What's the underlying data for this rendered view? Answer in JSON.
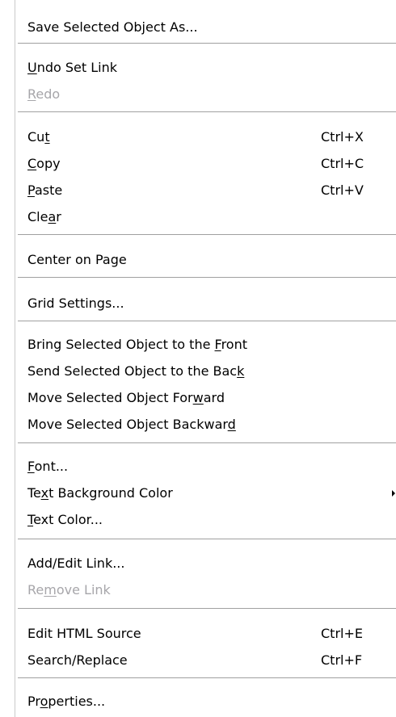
{
  "menu": {
    "save_selected": {
      "pre": "Save Selected Object As...",
      "u": "",
      "post": ""
    },
    "undo": {
      "pre": "",
      "u": "U",
      "post": "ndo Set Link"
    },
    "redo": {
      "pre": "",
      "u": "R",
      "post": "edo"
    },
    "cut": {
      "pre": "Cu",
      "u": "t",
      "post": "",
      "shortcut": "Ctrl+X"
    },
    "copy": {
      "pre": "",
      "u": "C",
      "post": "opy",
      "shortcut": "Ctrl+C"
    },
    "paste": {
      "pre": "",
      "u": "P",
      "post": "aste",
      "shortcut": "Ctrl+V"
    },
    "clear": {
      "pre": "Cle",
      "u": "a",
      "post": "r"
    },
    "center": {
      "pre": "Center on Page",
      "u": "",
      "post": ""
    },
    "grid": {
      "pre": "Grid Settings...",
      "u": "",
      "post": ""
    },
    "bring_front": {
      "pre": "Bring Selected Object to the ",
      "u": "F",
      "post": "ront"
    },
    "send_back": {
      "pre": "Send Selected Object to the Bac",
      "u": "k",
      "post": ""
    },
    "move_fwd": {
      "pre": "Move Selected Object For",
      "u": "w",
      "post": "ard"
    },
    "move_bwd": {
      "pre": "Move Selected Object Backwar",
      "u": "d",
      "post": ""
    },
    "font": {
      "pre": "",
      "u": "F",
      "post": "ont..."
    },
    "text_bg": {
      "pre": "Te",
      "u": "x",
      "post": "t Background Color"
    },
    "text_color": {
      "pre": "",
      "u": "T",
      "post": "ext Color..."
    },
    "add_link": {
      "pre": "Add/Edit Link...",
      "u": "",
      "post": ""
    },
    "remove_link": {
      "pre": "Re",
      "u": "m",
      "post": "ove Link"
    },
    "edit_html": {
      "pre": "Edit HTML Source",
      "u": "",
      "post": "",
      "shortcut": "Ctrl+E"
    },
    "search": {
      "pre": "Search/Replace",
      "u": "",
      "post": "",
      "shortcut": "Ctrl+F"
    },
    "properties": {
      "pre": "Pr",
      "u": "o",
      "post": "perties..."
    }
  },
  "colors": {
    "disabled": "#a7a6aa",
    "separator": "#a0a0a0",
    "background": "#ffffff"
  },
  "icons": {
    "submenu": "triangle-right-icon"
  }
}
